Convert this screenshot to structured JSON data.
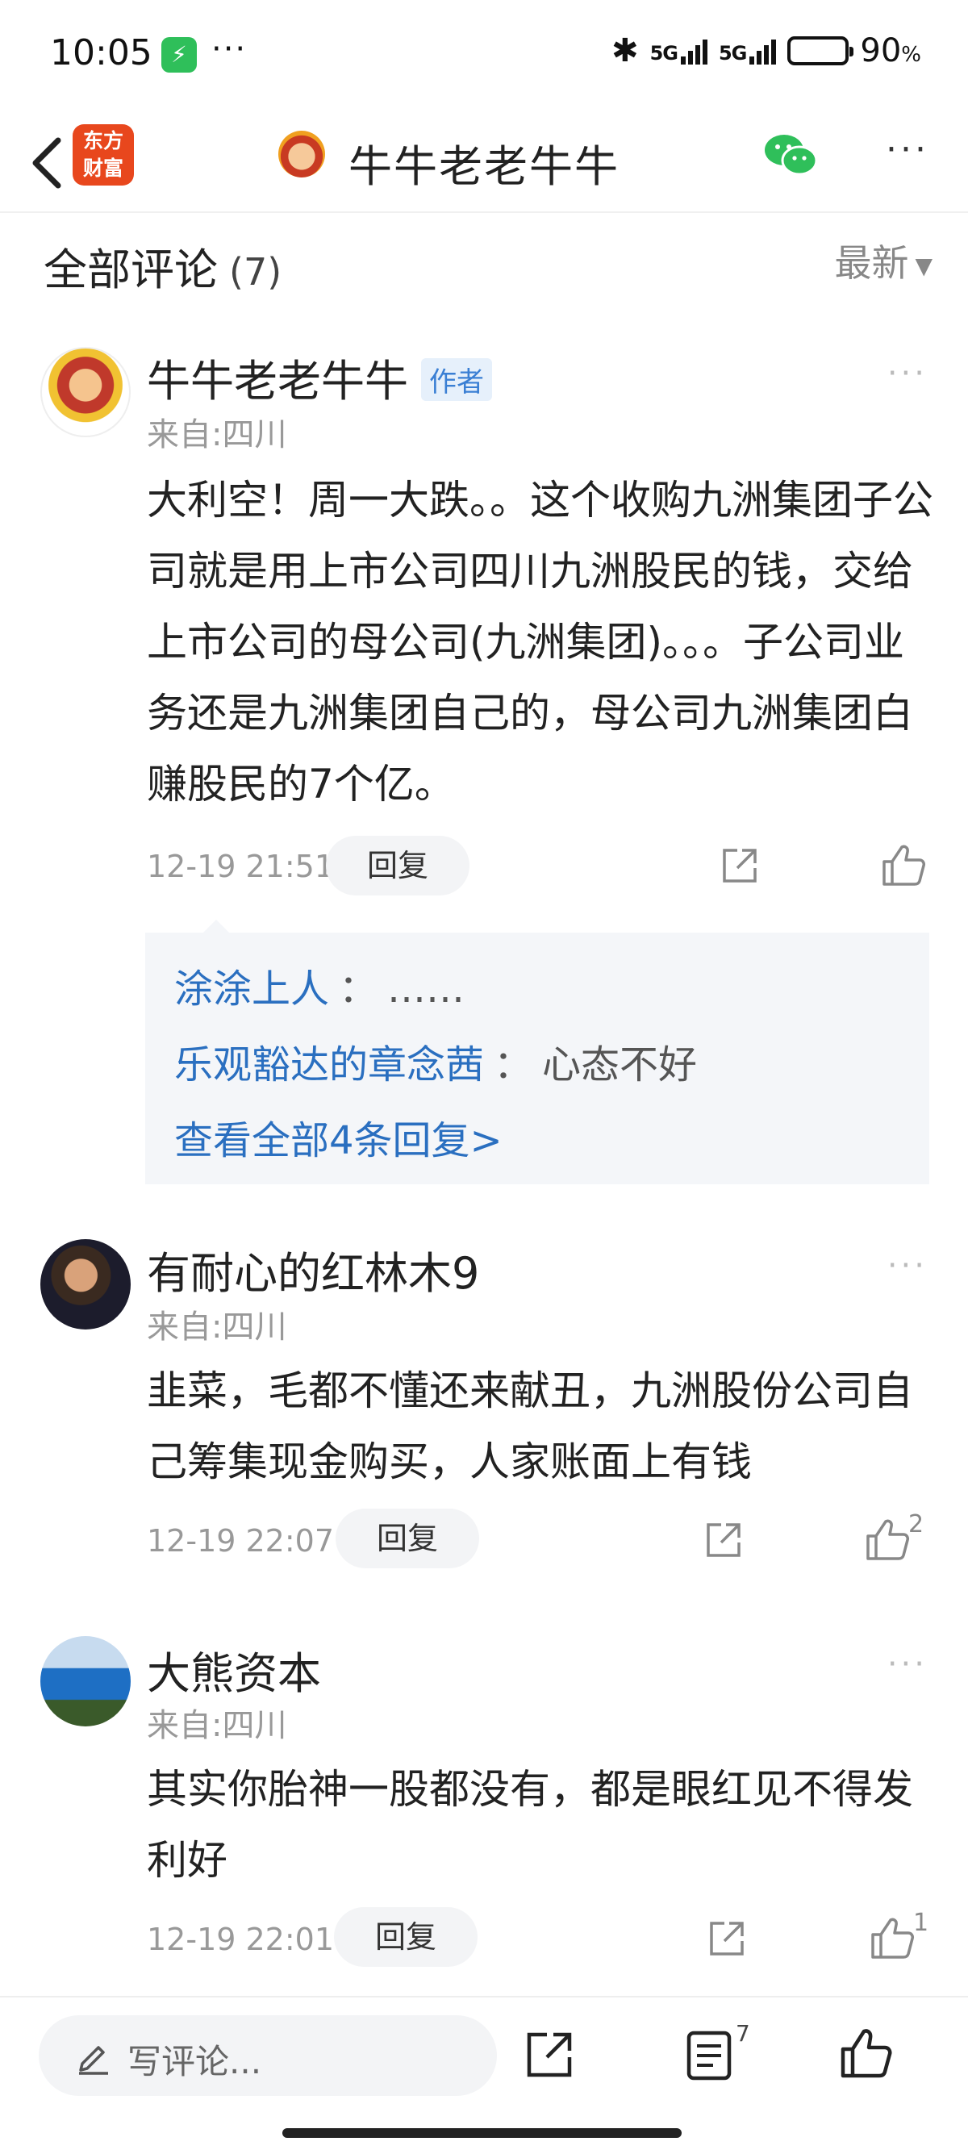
{
  "status_bar": {
    "time": "10:05",
    "dots": "···",
    "net1": "5G",
    "net2": "5G",
    "battery_percent": "90",
    "battery_unit": "%"
  },
  "nav": {
    "brand_line1": "东方",
    "brand_line2": "财富",
    "title": "牛牛老老牛牛",
    "more": "···"
  },
  "comments_header": {
    "title": "全部评论",
    "count": "(7)",
    "sort_label": "最新"
  },
  "comments": [
    {
      "name": "牛牛老老牛牛",
      "badge": "作者",
      "location": "来自:四川",
      "text": "大利空！周一大跌。。这个收购九洲集团子公司就是用上市公司四川九洲股民的钱，交给上市公司的母公司(九洲集团)。。。子公司业务还是九洲集团自己的，母公司九洲集团白赚股民的7个亿。",
      "time": "12-19 21:51",
      "reply_label": "回复",
      "likes": ""
    },
    {
      "name": "有耐心的红林木9",
      "location": "来自:四川",
      "text": "韭菜，毛都不懂还来献丑，九洲股份公司自己筹集现金购买，人家账面上有钱",
      "time": "12-19 22:07",
      "reply_label": "回复",
      "likes": "2"
    },
    {
      "name": "大熊资本",
      "location": "来自:四川",
      "text": "其实你胎神一股都没有，都是眼红见不得发利好",
      "time": "12-19 22:01",
      "reply_label": "回复",
      "likes": "1"
    }
  ],
  "replies": {
    "items": [
      {
        "name": "涂涂上人",
        "sep": "：",
        "text": "……"
      },
      {
        "name": "乐观豁达的章念茜",
        "sep": "：",
        "text": "心态不好"
      }
    ],
    "view_all": "查看全部4条回复>"
  },
  "bottom_bar": {
    "placeholder": "写评论...",
    "comment_count": "7"
  },
  "colors": {
    "link_blue": "#2a6fc0",
    "brand_orange": "#e8471d",
    "wechat_green": "#2fbf5a"
  }
}
